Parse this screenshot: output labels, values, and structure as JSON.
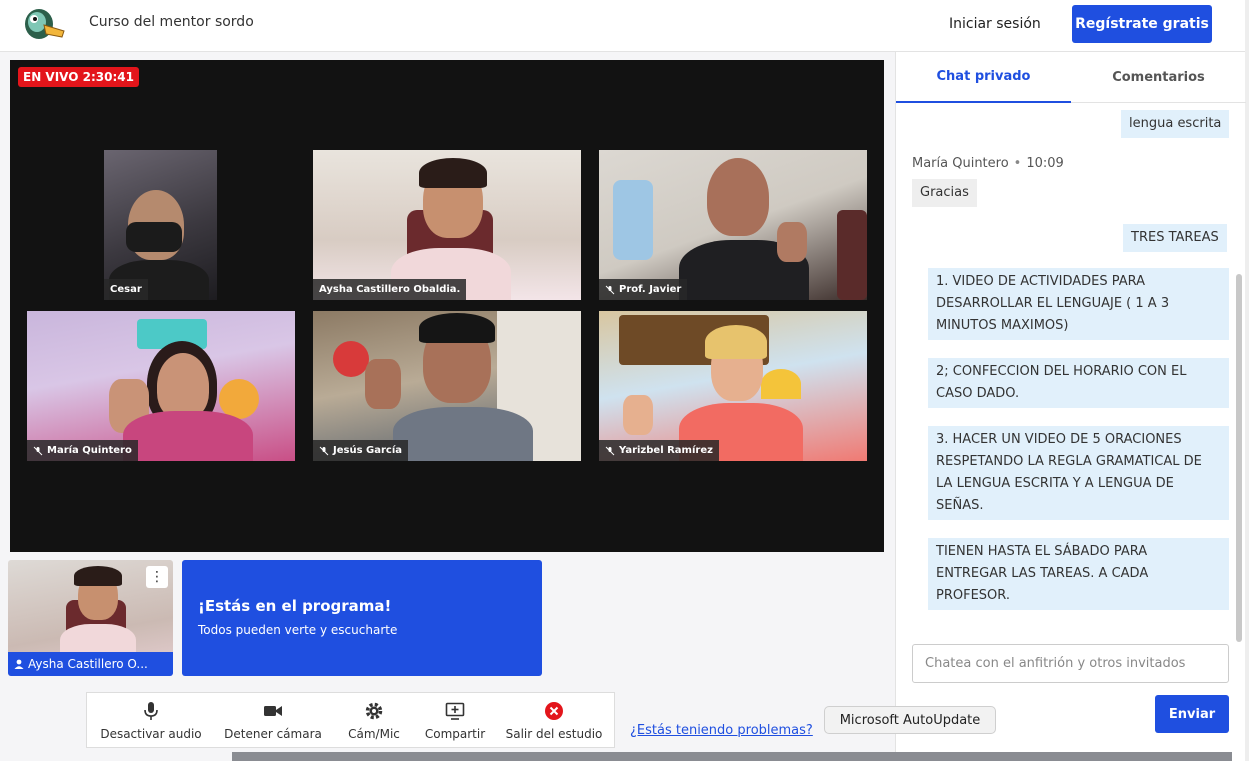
{
  "header": {
    "logo_icon": "duck-logo-icon",
    "course_title": "Curso del mentor sordo",
    "login_label": "Iniciar sesión",
    "register_label": "Regístrate gratis"
  },
  "stage": {
    "live_badge": "EN VIVO 2:30:41",
    "participants": [
      {
        "name": "Cesar",
        "muted": false
      },
      {
        "name": "Aysha Castillero Obaldia.",
        "muted": false
      },
      {
        "name": "Prof. Javier",
        "muted": true
      },
      {
        "name": "María Quintero",
        "muted": true
      },
      {
        "name": "Jesús García",
        "muted": true
      },
      {
        "name": "Yarizbel Ramírez",
        "muted": true
      }
    ]
  },
  "self_view": {
    "name": "Aysha Castillero O...",
    "menu_icon": "kebab-menu-icon"
  },
  "program_notice": {
    "title": "¡Estás en el programa!",
    "subtitle": "Todos pueden verte y escucharte"
  },
  "controls": {
    "mute_audio": "Desactivar audio",
    "stop_camera": "Detener cámara",
    "cam_mic": "Cám/Mic",
    "share": "Compartir",
    "leave": "Salir del estudio"
  },
  "help_link": "¿Estás teniendo problemas?",
  "sidebar": {
    "tabs": [
      "Chat privado",
      "Comentarios"
    ],
    "messages": {
      "m1": "lengua escrita",
      "author": "María Quintero",
      "time": "10:09",
      "m2": "Gracias",
      "m3": "TRES TAREAS",
      "m4": "1. VIDEO DE ACTIVIDADES PARA DESARROLLAR EL LENGUAJE ( 1 A 3 MINUTOS MAXIMOS)",
      "m5": "2; CONFECCION DEL HORARIO CON EL CASO DADO.",
      "m6": "3. HACER UN VIDEO DE 5 ORACIONES RESPETANDO LA REGLA GRAMATICAL DE LA LENGUA ESCRITA Y A LENGUA DE SEÑAS.",
      "m7": "TIENEN HASTA EL SÁBADO PARA ENTREGAR LAS TAREAS. A CADA PROFESOR."
    },
    "input_placeholder": "Chatea con el anfitrión y otros invitados",
    "send_label": "Enviar"
  },
  "tooltip": "Microsoft AutoUpdate",
  "colors": {
    "accent": "#1f4fe0",
    "live": "#e3151b",
    "my_bubble": "#e1f0fb"
  }
}
